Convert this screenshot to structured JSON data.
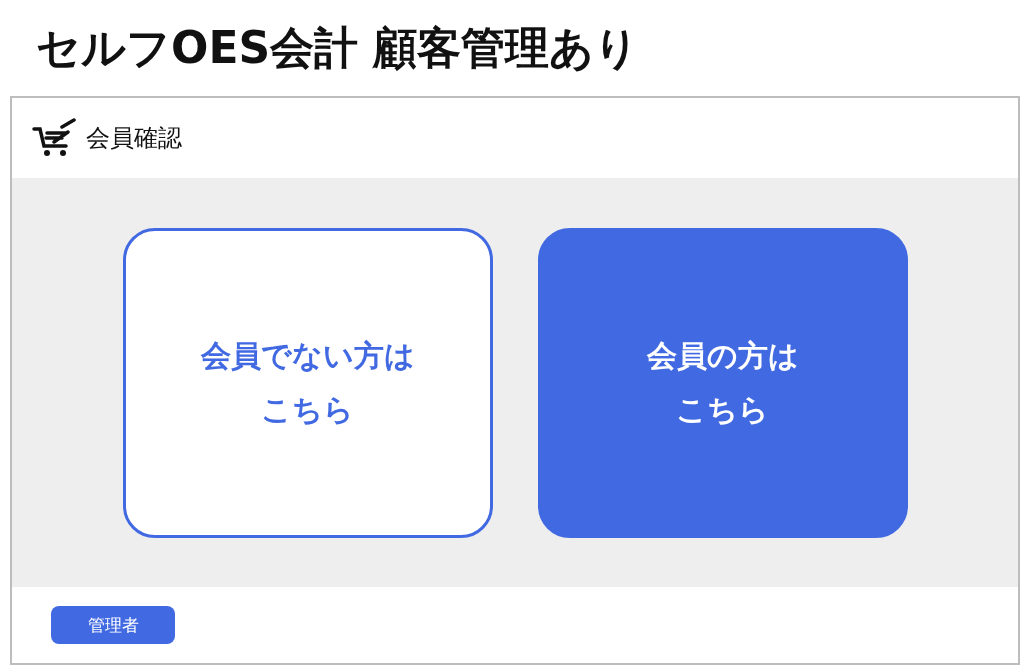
{
  "page_title": "セルフOES会計 顧客管理あり",
  "header": {
    "title": "会員確認"
  },
  "choices": [
    {
      "label": "会員でない方はこちら",
      "kind": "outline"
    },
    {
      "label": "会員の方はこちら",
      "kind": "filled"
    }
  ],
  "footer": {
    "admin_button": "管理者"
  }
}
